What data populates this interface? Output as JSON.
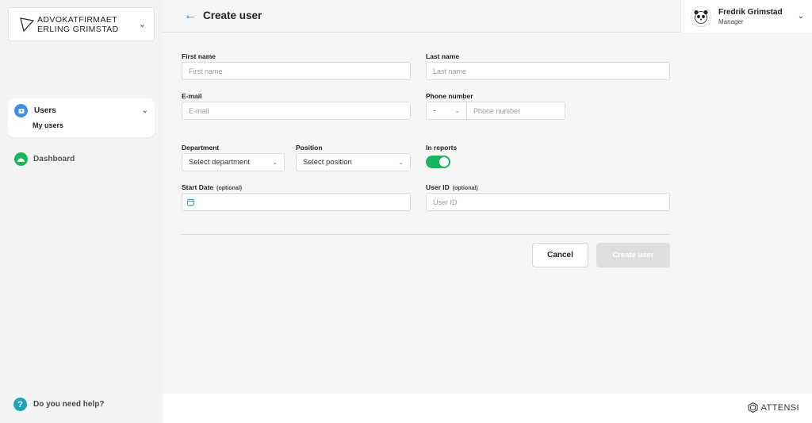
{
  "org": {
    "line1": "ADVOKATFIRMAET",
    "line2": "ERLING GRIMSTAD"
  },
  "sidebar": {
    "users_label": "Users",
    "my_users_label": "My users",
    "dashboard_label": "Dashboard",
    "help_label": "Do you need help?"
  },
  "header": {
    "title": "Create user"
  },
  "user": {
    "name": "Fredrik Grimstad",
    "role": "Manager"
  },
  "form": {
    "first_name_label": "First name",
    "first_name_placeholder": "First name",
    "last_name_label": "Last name",
    "last_name_placeholder": "Last name",
    "email_label": "E-mail",
    "email_placeholder": "E-mail",
    "phone_label": "Phone number",
    "phone_prefix_value": "-",
    "phone_placeholder": "Phone number",
    "department_label": "Department",
    "department_value": "Select department",
    "position_label": "Position",
    "position_value": "Select position",
    "in_reports_label": "In reports",
    "in_reports_on": true,
    "start_date_label": "Start Date",
    "start_date_optional": "(optional)",
    "user_id_label": "User ID",
    "user_id_optional": "(optional)",
    "user_id_placeholder": "User ID"
  },
  "actions": {
    "cancel_label": "Cancel",
    "create_label": "Create user"
  },
  "footer": {
    "brand": "ATTENSI"
  },
  "colors": {
    "accent": "#1976d2",
    "toggle_on": "#16b85c",
    "users_icon": "#3b8ef0",
    "dashboard_icon": "#16b85c",
    "help_icon": "#1aa6b7"
  }
}
